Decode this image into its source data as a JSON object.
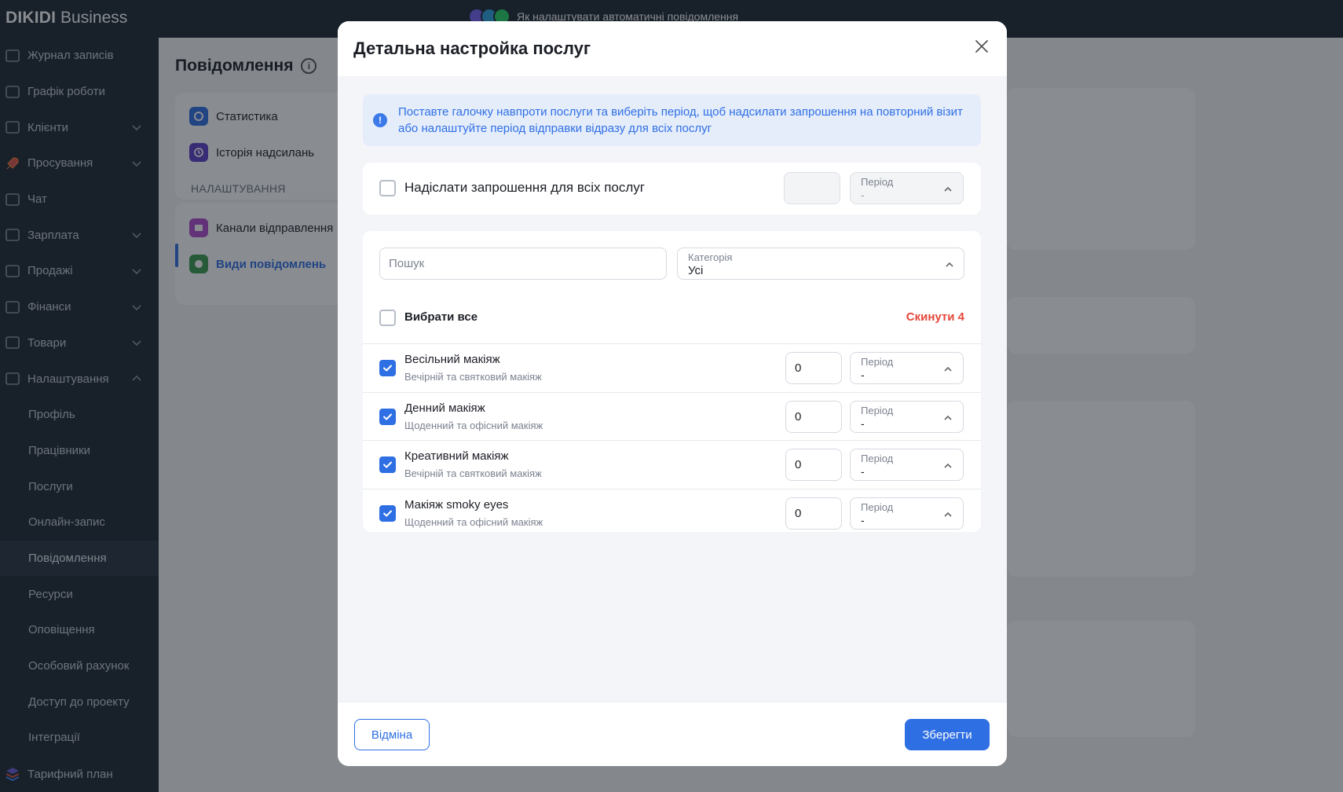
{
  "app": {
    "brand_bold": "DIKIDI",
    "brand_rest": " Business"
  },
  "promo": {
    "text": "Як налаштувати автоматичні повідомлення"
  },
  "sidebar": {
    "items": [
      {
        "label": "Журнал записів",
        "icon": "journal-icon",
        "chevron": false
      },
      {
        "label": "Графік роботи",
        "icon": "calendar-icon",
        "chevron": false
      },
      {
        "label": "Клієнти",
        "icon": "clients-icon",
        "chevron": true
      },
      {
        "label": "Просування",
        "icon": "rocket-icon",
        "chevron": true
      },
      {
        "label": "Чат",
        "icon": "chat-icon",
        "chevron": false
      },
      {
        "label": "Зарплата",
        "icon": "salary-icon",
        "chevron": true
      },
      {
        "label": "Продажі",
        "icon": "sales-icon",
        "chevron": true
      },
      {
        "label": "Фінанси",
        "icon": "finance-icon",
        "chevron": true
      },
      {
        "label": "Товари",
        "icon": "goods-icon",
        "chevron": true
      },
      {
        "label": "Налаштування",
        "icon": "gear-icon",
        "chevron": true
      }
    ],
    "sub_items": [
      "Профіль",
      "Працівники",
      "Послуги",
      "Онлайн-запис",
      "Повідомлення",
      "Ресурси",
      "Оповіщення",
      "Особовий рахунок",
      "Доступ до проекту",
      "Інтеграції"
    ],
    "active_sub": "Повідомлення",
    "bottom_item": "Тарифний план"
  },
  "page": {
    "title": "Повідомлення",
    "nav_top": [
      "Статистика",
      "Історія надсилань"
    ],
    "section_caption": "НАЛАШТУВАННЯ",
    "nav_settings": [
      "Канали відправлення",
      "Види повідомлень"
    ]
  },
  "modal": {
    "title": "Детальна настройка послуг",
    "info": "Поставте галочку навпроти послуги та виберіть період, щоб надсилати запрошення на повторний візит або налаштуйте період відправки відразу для всіх послуг",
    "send_all_label": "Надіслати запрошення для всіх послуг",
    "send_all_checked": false,
    "send_all_period_label": "Період",
    "send_all_period_value": "-",
    "search_placeholder": "Пошук",
    "category_label": "Категорія",
    "category_value": "Усі",
    "select_all_label": "Вибрати все",
    "reset_label": "Скинути 4",
    "services": [
      {
        "name": "Весільний макіяж",
        "category": "Вечірній та святковий макіяж",
        "checked": true,
        "value": "0",
        "period_label": "Період",
        "period_value": "-"
      },
      {
        "name": "Денний макіяж",
        "category": "Щоденний та офісний макіяж",
        "checked": true,
        "value": "0",
        "period_label": "Період",
        "period_value": "-"
      },
      {
        "name": "Креативний макіяж",
        "category": "Вечірній та святковий макіяж",
        "checked": true,
        "value": "0",
        "period_label": "Період",
        "period_value": "-"
      },
      {
        "name": "Макіяж smoky eyes",
        "category": "Щоденний та офісний макіяж",
        "checked": true,
        "value": "0",
        "period_label": "Період",
        "period_value": "-"
      }
    ],
    "cancel_label": "Відміна",
    "save_label": "Зберегти"
  },
  "colors": {
    "accent": "#2f6fe4",
    "danger": "#e5483b",
    "sidebar_bg": "#1d2733",
    "info_bg": "#e5edfb"
  }
}
